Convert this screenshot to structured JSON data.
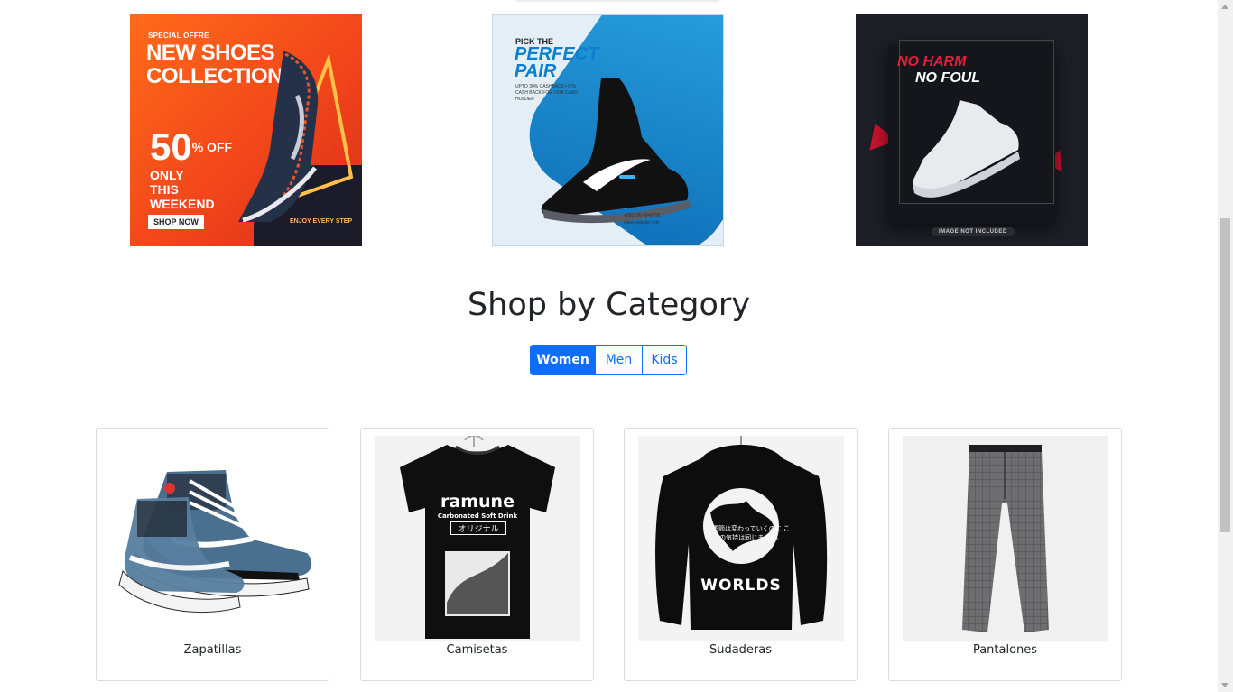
{
  "banners": [
    {
      "id": "banner-1",
      "small": "SPECIAL OFFRE",
      "title": "NEW SHOES COLLECTION",
      "percent": "50",
      "percent_suffix": "% OFF",
      "only": "ONLY THIS WEEKEND",
      "cta": "SHOP NOW",
      "footer": "ENJOY EVERY STEP"
    },
    {
      "id": "banner-2",
      "pick": "PICK THE",
      "headline": "PERFECT PAIR",
      "fine": "UPTO 30% CASHBACK+70% CASH BACK FOR VISA CARD HOLDER",
      "phone": "+880195 4949795",
      "web": "www.website.com"
    },
    {
      "id": "banner-3",
      "line1": "NO HARM",
      "line2": "NO FOUL",
      "tag": "IMAGE NOT INCLUDED"
    }
  ],
  "shop": {
    "title": "Shop by Category",
    "tabs": [
      {
        "label": "Women",
        "active": true
      },
      {
        "label": "Men",
        "active": false
      },
      {
        "label": "Kids",
        "active": false
      }
    ]
  },
  "categories": [
    {
      "label": "Zapatillas",
      "icon": "sneaker-image"
    },
    {
      "label": "Camisetas",
      "icon": "tshirt-image",
      "print_title": "ramune",
      "print_sub": "Carbonated Soft Drink",
      "print_jp": "オリジナル"
    },
    {
      "label": "Sudaderas",
      "icon": "hoodie-image",
      "print_jp": "季節は変わっていくのに この気持は同じままだ。",
      "print_word": "WORLDS"
    },
    {
      "label": "Pantalones",
      "icon": "trousers-image"
    }
  ],
  "colors": {
    "primary": "#0d6efd",
    "text": "#212529",
    "banner1": "#f2461b",
    "banner2": "#0a7fd0",
    "banner3": "#1d1f26"
  }
}
